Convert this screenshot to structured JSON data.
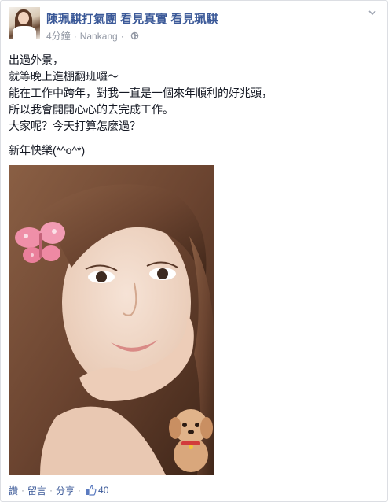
{
  "post": {
    "page_name": "陳珮騏打氣團 看見真實 看見珮騏",
    "time": "4分鐘",
    "separator": "·",
    "location": "Nankang",
    "text_lines": [
      "出過外景，",
      "就等晚上進棚翻班囉～",
      "能在工作中跨年，對我一直是一個來年順利的好兆頭，",
      "所以我會開開心心的去完成工作。",
      "大家呢？今天打算怎麼過？"
    ],
    "closing_line": "新年快樂(*^o^*)"
  },
  "actions": {
    "like_label": "讚",
    "comment_label": "留言",
    "share_label": "分享",
    "dot": "·",
    "like_count": "40"
  },
  "colors": {
    "link": "#3b5998",
    "meta": "#9197a3",
    "text": "#141823"
  },
  "icons": {
    "privacy": "globe-icon",
    "options": "chevron-down-icon",
    "likes": "thumbs-up-icon"
  }
}
